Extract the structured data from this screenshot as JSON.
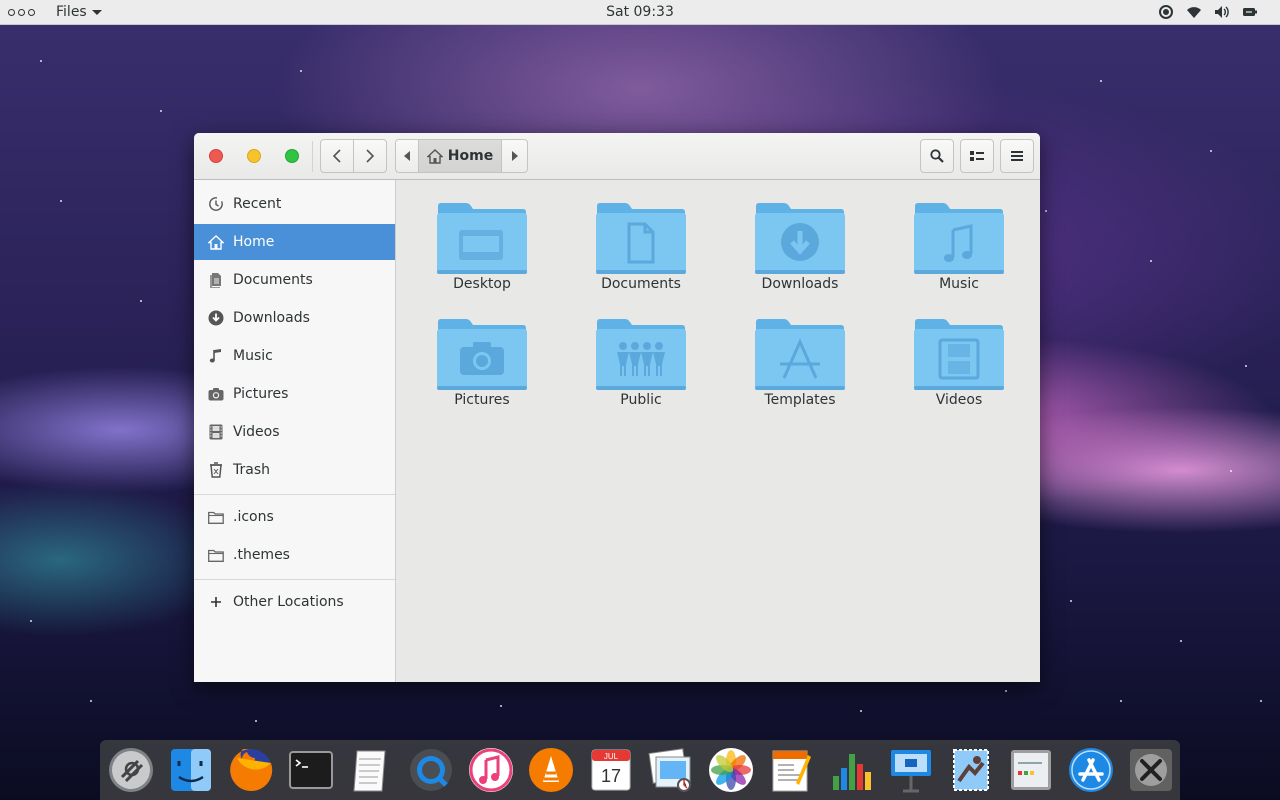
{
  "topbar": {
    "app_name": "Files",
    "clock": "Sat 09:33"
  },
  "window": {
    "path_current": "Home"
  },
  "sidebar": {
    "items": [
      {
        "label": "Recent",
        "icon": "recent-icon"
      },
      {
        "label": "Home",
        "icon": "home-icon",
        "active": true
      },
      {
        "label": "Documents",
        "icon": "documents-icon"
      },
      {
        "label": "Downloads",
        "icon": "downloads-icon"
      },
      {
        "label": "Music",
        "icon": "music-icon"
      },
      {
        "label": "Pictures",
        "icon": "pictures-icon"
      },
      {
        "label": "Videos",
        "icon": "videos-icon"
      },
      {
        "label": "Trash",
        "icon": "trash-icon"
      }
    ],
    "bookmarks": [
      {
        "label": ".icons",
        "icon": "folder-icon"
      },
      {
        "label": ".themes",
        "icon": "folder-icon"
      }
    ],
    "other": {
      "label": "Other Locations",
      "icon": "plus-icon"
    }
  },
  "folders": [
    {
      "label": "Desktop",
      "emblem": "desktop-emblem"
    },
    {
      "label": "Documents",
      "emblem": "document-emblem"
    },
    {
      "label": "Downloads",
      "emblem": "download-emblem"
    },
    {
      "label": "Music",
      "emblem": "music-emblem"
    },
    {
      "label": "Pictures",
      "emblem": "camera-emblem"
    },
    {
      "label": "Public",
      "emblem": "people-emblem"
    },
    {
      "label": "Templates",
      "emblem": "templates-emblem"
    },
    {
      "label": "Videos",
      "emblem": "film-emblem"
    }
  ],
  "dock": {
    "items": [
      "launchpad-icon",
      "finder-icon",
      "firefox-icon",
      "terminal-icon",
      "text-editor-icon",
      "quicktime-icon",
      "itunes-icon",
      "vlc-icon",
      "calendar-icon",
      "preview-icon",
      "photos-icon",
      "pages-icon",
      "numbers-icon",
      "keynote-icon",
      "mail-icon",
      "system-preferences-icon",
      "app-store-icon",
      "utilities-icon"
    ],
    "calendar_month": "JUL",
    "calendar_day": "17"
  },
  "colors": {
    "accent": "#4a90d9",
    "folder": "#7cc6f2",
    "close": "#ee5a52",
    "minimize": "#f6c22e",
    "maximize": "#2fc543"
  }
}
